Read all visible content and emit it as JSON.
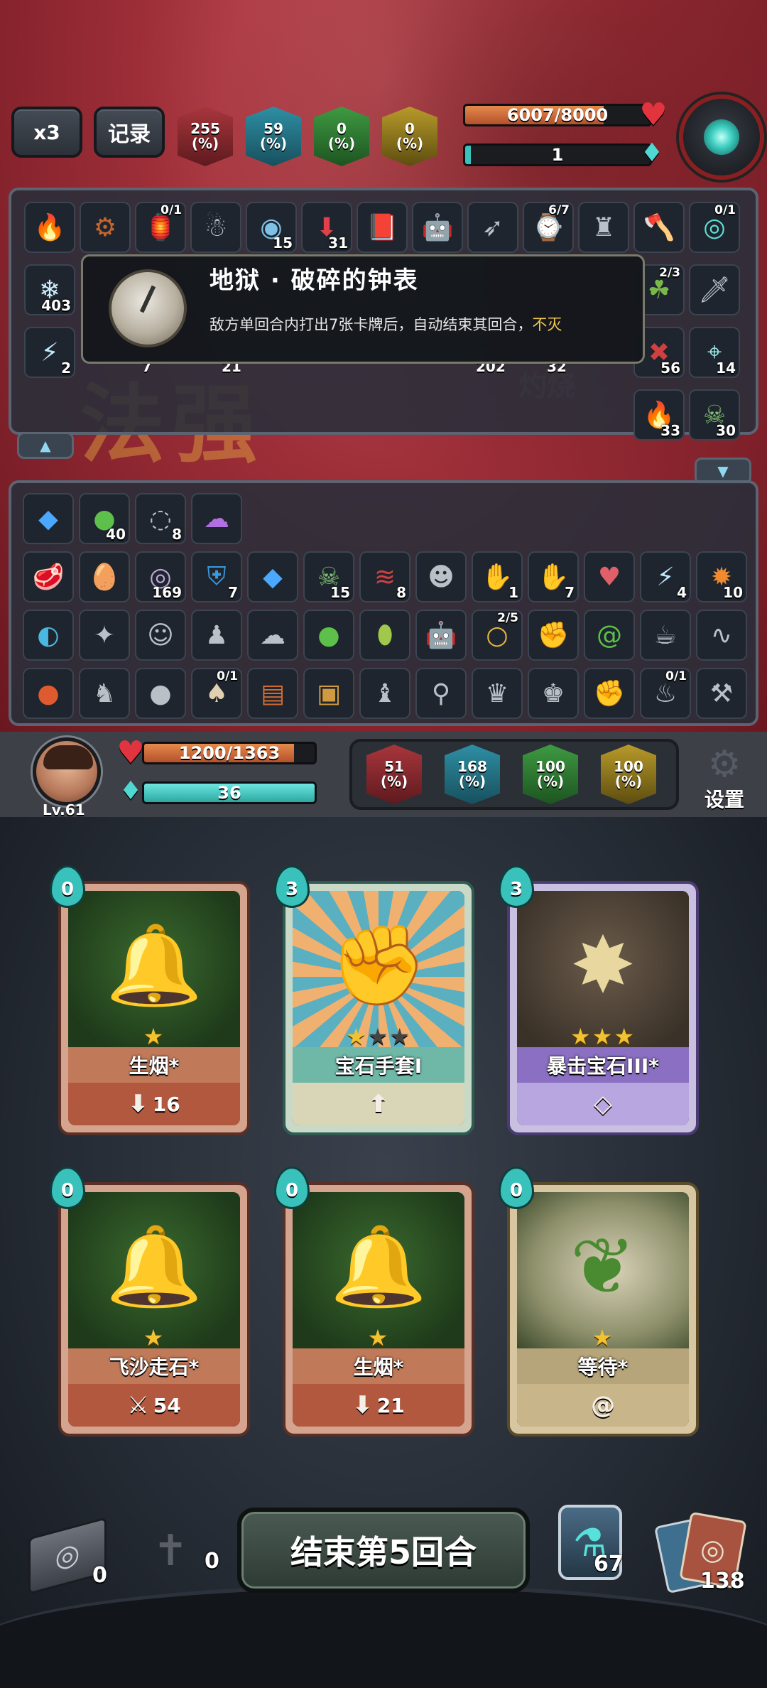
{
  "top_bar": {
    "speed_label": "x3",
    "log_label": "记录",
    "enemy_stats": [
      {
        "name": "attack",
        "value": "255",
        "unit": "(%)",
        "color": "#a8363c"
      },
      {
        "name": "magic",
        "value": "59",
        "unit": "(%)",
        "color": "#2f8fa4"
      },
      {
        "name": "defense",
        "value": "0",
        "unit": "(%)",
        "color": "#3e9a42"
      },
      {
        "name": "power",
        "value": "0",
        "unit": "(%)",
        "color": "#b89a2a"
      }
    ],
    "enemy_hp": {
      "text": "6007/8000",
      "current": 6007,
      "max": 8000
    },
    "enemy_mana": {
      "text": "1"
    }
  },
  "enemy_items": {
    "row1": [
      {
        "icon": "torch-icon"
      },
      {
        "icon": "gear-icon"
      },
      {
        "icon": "lantern-icon",
        "frac": "0/1"
      },
      {
        "icon": "ghost-doll-icon"
      },
      {
        "icon": "orb-icon",
        "count": "15"
      },
      {
        "icon": "down-arrow-icon",
        "count": "31"
      },
      {
        "icon": "book-icon"
      },
      {
        "icon": "robot-icon"
      },
      {
        "icon": "arrows-icon"
      },
      {
        "icon": "pocket-watch-icon",
        "frac": "6/7"
      },
      {
        "icon": "pillar-icon"
      },
      {
        "icon": "axe-icon"
      },
      {
        "icon": "cyan-orb-icon",
        "frac": "0/1"
      }
    ],
    "row2_left": {
      "icon": "snowflake-icon",
      "count": "403"
    },
    "row2_right": [
      {
        "icon": "plant-icon",
        "frac": "2/3"
      },
      {
        "icon": "dagger-icon"
      }
    ],
    "row3_left": {
      "icon": "lightning-icon",
      "count": "2"
    },
    "row3_hidden_counts": [
      "7",
      "21",
      "202",
      "32"
    ],
    "row3_right": [
      {
        "icon": "claw-icon",
        "count": "56"
      },
      {
        "icon": "crosshair-icon",
        "count": "14"
      }
    ],
    "row4_right": [
      {
        "icon": "fire-icon",
        "count": "33"
      },
      {
        "icon": "skull-icon",
        "count": "30"
      }
    ]
  },
  "tooltip": {
    "title": "地狱 · 破碎的钟表",
    "description": "敌方单回合内打出7张卡牌后，自动结束其回合，",
    "keyword": "不灭"
  },
  "background_text": {
    "big_word": "法强",
    "burn_label": "灼烧"
  },
  "player_items": {
    "row1": [
      {
        "icon": "blue-gem-icon"
      },
      {
        "icon": "green-slime-icon",
        "count": "40"
      },
      {
        "icon": "crossed-eye-icon",
        "count": "8"
      },
      {
        "icon": "purple-ghost-icon"
      }
    ],
    "row2": [
      {
        "icon": "meat-icon"
      },
      {
        "icon": "egg-icon"
      },
      {
        "icon": "vortex-icon",
        "count": "169"
      },
      {
        "icon": "shield-icon",
        "count": "7"
      },
      {
        "icon": "blue-gem-icon"
      },
      {
        "icon": "skull-icon",
        "count": "15"
      },
      {
        "icon": "claw-marks-icon",
        "count": "8"
      },
      {
        "icon": "stone-face-icon"
      },
      {
        "icon": "dark-hand-icon",
        "count": "1"
      },
      {
        "icon": "purple-hand-icon",
        "count": "7"
      },
      {
        "icon": "crystal-heart-icon"
      },
      {
        "icon": "lightning-icon",
        "count": "4"
      },
      {
        "icon": "flame-ring-icon",
        "count": "10"
      }
    ],
    "row3": [
      {
        "icon": "whale-icon"
      },
      {
        "icon": "beetle-icon"
      },
      {
        "icon": "mask-icon"
      },
      {
        "icon": "hooded-icon"
      },
      {
        "icon": "ghost-icon"
      },
      {
        "icon": "green-slime-icon"
      },
      {
        "icon": "green-egg-icon"
      },
      {
        "icon": "robot-icon"
      },
      {
        "icon": "ring-icon",
        "frac": "2/5"
      },
      {
        "icon": "red-glove-icon"
      },
      {
        "icon": "swirl-icon"
      },
      {
        "icon": "teapot-icon"
      },
      {
        "icon": "snake-icon"
      }
    ],
    "row4": [
      {
        "icon": "fire-apple-icon"
      },
      {
        "icon": "pig-icon"
      },
      {
        "icon": "bomb-icon"
      },
      {
        "icon": "mushroom-icon",
        "frac": "0/1"
      },
      {
        "icon": "spellbook-icon"
      },
      {
        "icon": "chest-icon"
      },
      {
        "icon": "wizard-icon"
      },
      {
        "icon": "lever-icon"
      },
      {
        "icon": "owl-icon"
      },
      {
        "icon": "witch-icon"
      },
      {
        "icon": "boxing-glove-icon"
      },
      {
        "icon": "sack-icon",
        "frac": "0/1"
      },
      {
        "icon": "pickaxe-icon"
      }
    ]
  },
  "player": {
    "level": "Lv.61",
    "hp": {
      "text": "1200/1363",
      "current": 1200,
      "max": 1363
    },
    "mana": {
      "text": "36"
    },
    "stats": [
      {
        "name": "attack",
        "value": "51",
        "unit": "(%)"
      },
      {
        "name": "magic",
        "value": "168",
        "unit": "(%)"
      },
      {
        "name": "defense",
        "value": "100",
        "unit": "(%)"
      },
      {
        "name": "power",
        "value": "100",
        "unit": "(%)"
      }
    ],
    "settings_label": "设置"
  },
  "hand": [
    {
      "cost": "0",
      "name": "生烟*",
      "footer": "16",
      "footer_icon": "down-arrow-icon",
      "stars": 1,
      "max_stars": 1,
      "frame": "red",
      "art": "bells-icon"
    },
    {
      "cost": "3",
      "name": "宝石手套I",
      "footer": "",
      "footer_icon": "up-arrow-icon",
      "stars": 1,
      "max_stars": 3,
      "frame": "teal",
      "art": "gem-gauntlet-icon"
    },
    {
      "cost": "3",
      "name": "暴击宝石III*",
      "footer": "",
      "footer_icon": "diamond-icon",
      "stars": 3,
      "max_stars": 3,
      "frame": "purple",
      "art": "crit-gem-icon"
    },
    {
      "cost": "0",
      "name": "飞沙走石*",
      "footer": "54",
      "footer_icon": "sword-icon",
      "stars": 1,
      "max_stars": 1,
      "frame": "red",
      "art": "bells-wind-icon"
    },
    {
      "cost": "0",
      "name": "生烟*",
      "footer": "21",
      "footer_icon": "down-arrow-icon",
      "stars": 1,
      "max_stars": 1,
      "frame": "red",
      "art": "bells-icon"
    },
    {
      "cost": "0",
      "name": "等待*",
      "footer": "",
      "footer_icon": "spiral-icon",
      "stars": 1,
      "max_stars": 1,
      "frame": "gold",
      "art": "vine-icon"
    }
  ],
  "bottom": {
    "discard_count": "0",
    "grave_count": "0",
    "end_turn_label": "结束第5回合",
    "potion_count": "67",
    "deck_count": "138"
  }
}
